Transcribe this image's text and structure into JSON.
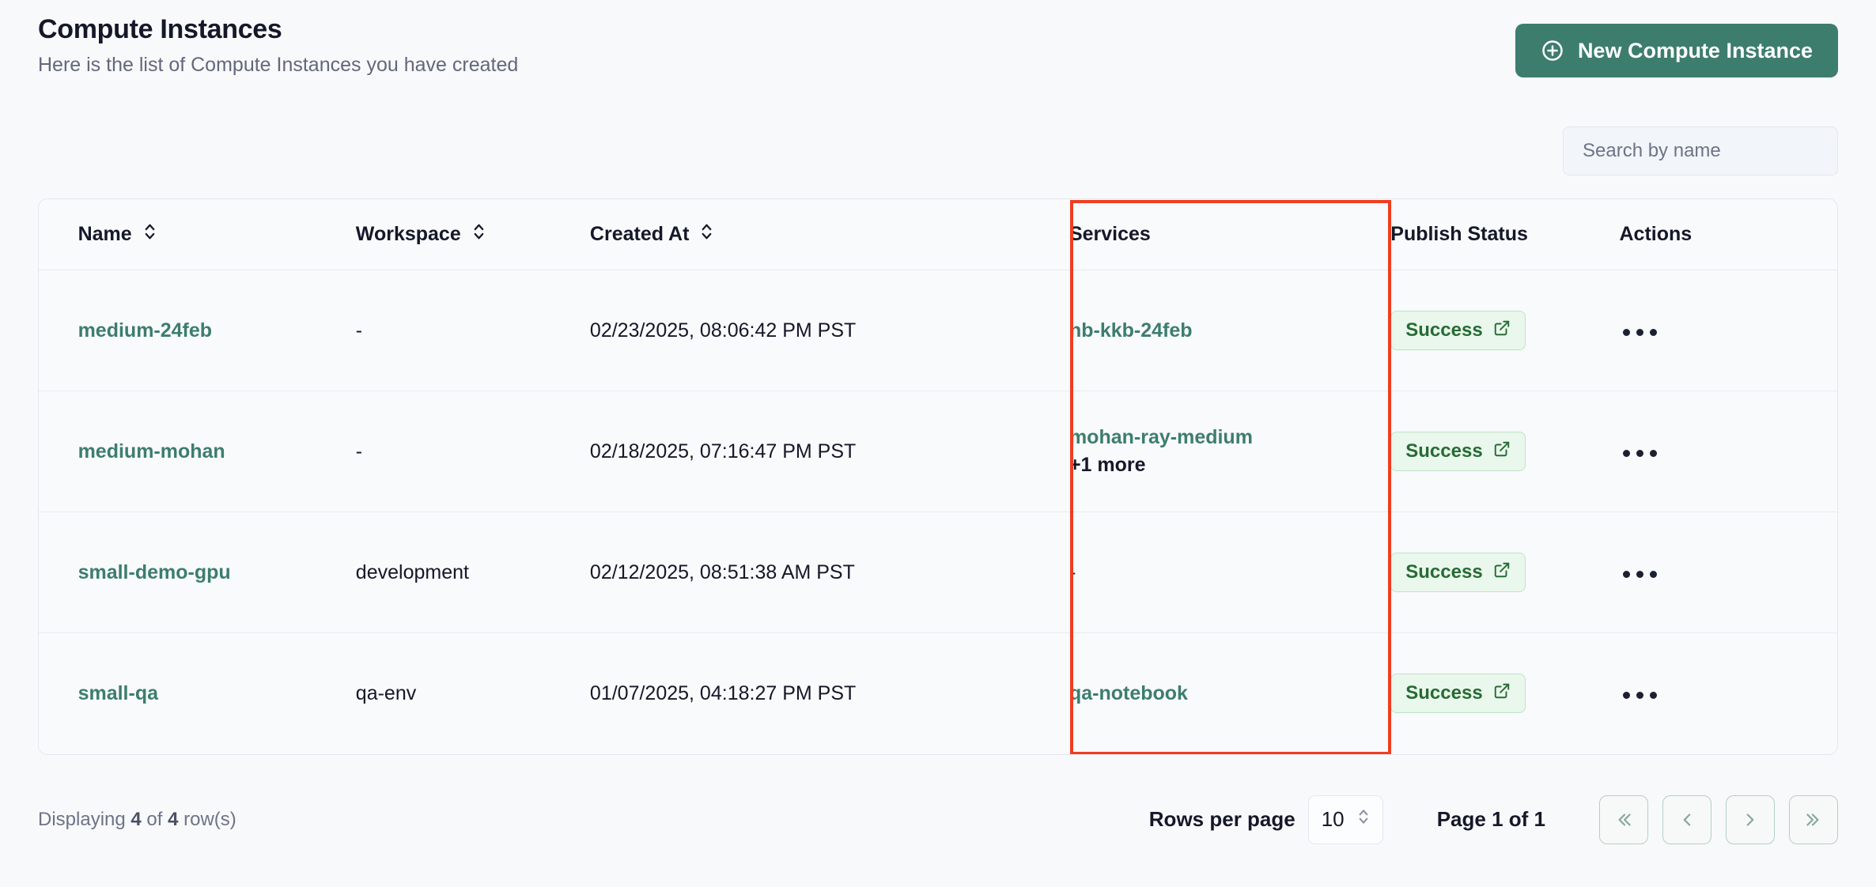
{
  "header": {
    "title": "Compute Instances",
    "subtitle": "Here is the list of Compute Instances you have created",
    "new_button_label": "New Compute Instance",
    "new_button_icon": "plus-circle-icon",
    "accent_color": "#3d7d6e"
  },
  "search": {
    "placeholder": "Search by name",
    "value": ""
  },
  "table": {
    "columns": [
      {
        "label": "Name",
        "sortable": true
      },
      {
        "label": "Workspace",
        "sortable": true
      },
      {
        "label": "Created At",
        "sortable": true
      },
      {
        "label": "Services",
        "sortable": false
      },
      {
        "label": "Publish Status",
        "sortable": false
      },
      {
        "label": "Actions",
        "sortable": false
      }
    ],
    "rows": [
      {
        "name": "medium-24feb",
        "workspace": "-",
        "created_at": "02/23/2025, 08:06:42 PM PST",
        "services": [
          "nb-kkb-24feb"
        ],
        "services_more": "",
        "publish_status": "Success",
        "actions": "•••"
      },
      {
        "name": "medium-mohan",
        "workspace": "-",
        "created_at": "02/18/2025, 07:16:47 PM PST",
        "services": [
          "mohan-ray-medium"
        ],
        "services_more": "+1 more",
        "publish_status": "Success",
        "actions": "•••"
      },
      {
        "name": "small-demo-gpu",
        "workspace": "development",
        "created_at": "02/12/2025, 08:51:38 AM PST",
        "services": [
          "-"
        ],
        "services_more": "",
        "publish_status": "Success",
        "actions": "•••"
      },
      {
        "name": "small-qa",
        "workspace": "qa-env",
        "created_at": "01/07/2025, 04:18:27 PM PST",
        "services": [
          "qa-notebook"
        ],
        "services_more": "",
        "publish_status": "Success",
        "actions": "•••"
      }
    ],
    "highlight": {
      "column": "Services",
      "color": "#ef3e21"
    }
  },
  "footer": {
    "displaying_prefix": "Displaying ",
    "displayed_count": "4",
    "displaying_mid": " of ",
    "total_count": "4",
    "displaying_suffix": " row(s)",
    "rows_per_page_label": "Rows per page",
    "rows_per_page_value": "10",
    "page_indicator": "Page 1 of 1",
    "pagination": [
      {
        "name": "first-page",
        "glyph": "«"
      },
      {
        "name": "previous-page",
        "glyph": "‹"
      },
      {
        "name": "next-page",
        "glyph": "›"
      },
      {
        "name": "last-page",
        "glyph": "»"
      }
    ]
  },
  "status_colors": {
    "success_bg": "#eaf7ec",
    "success_border": "#bfe3c6",
    "success_text": "#266b34"
  }
}
